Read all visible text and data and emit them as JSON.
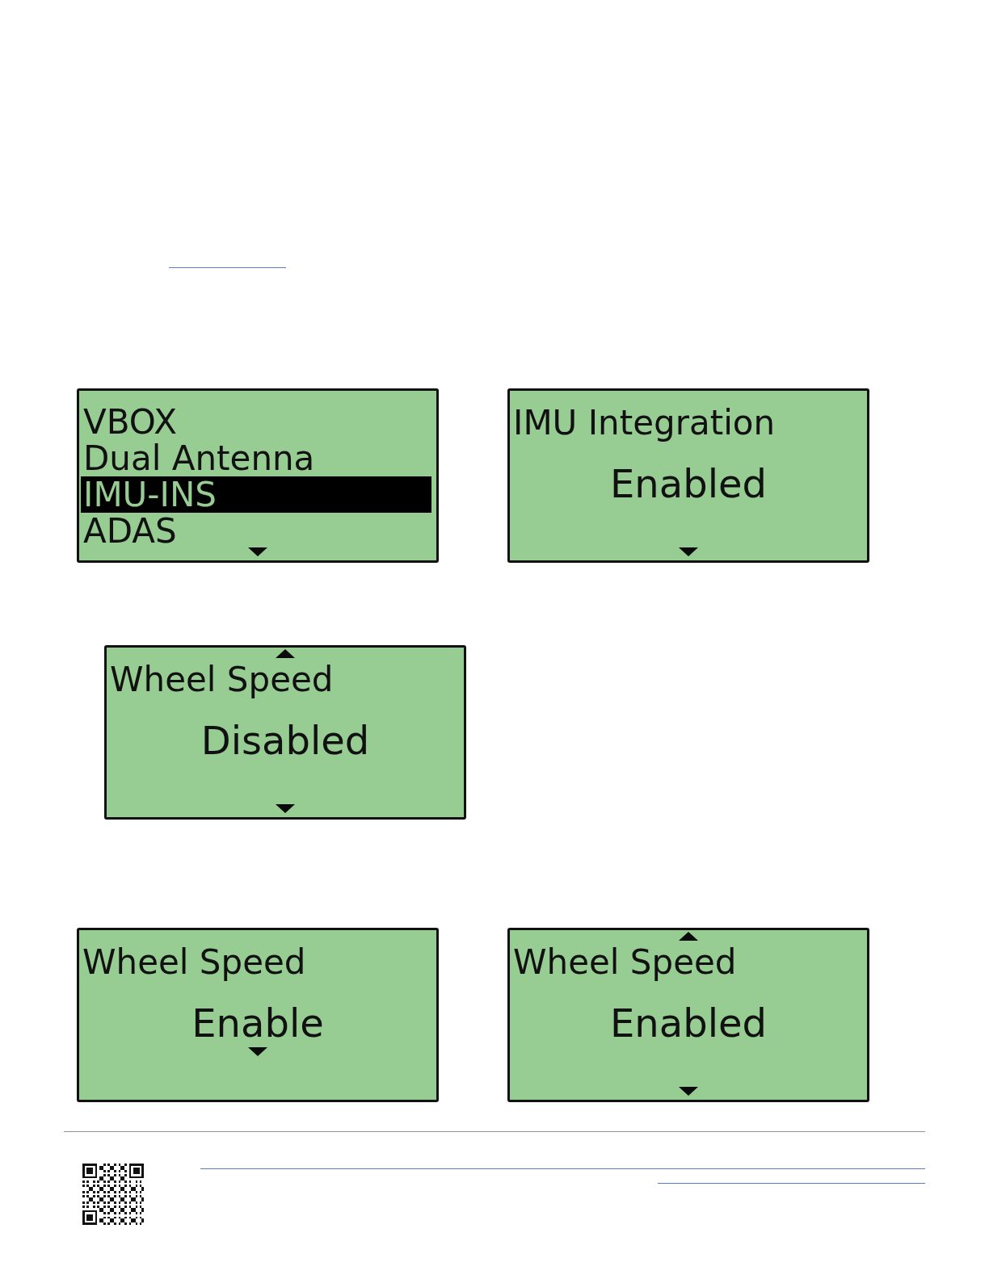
{
  "display_rows": [
    {
      "screens": [
        {
          "kind": "menu",
          "items": [
            {
              "label": "VBOX",
              "selected": false
            },
            {
              "label": "Dual Antenna",
              "selected": false
            },
            {
              "label": "IMU-INS",
              "selected": true
            },
            {
              "label": "ADAS",
              "selected": false
            }
          ],
          "scroll_up": false,
          "scroll_down": true
        },
        {
          "kind": "setting",
          "title": "IMU Integration",
          "value": "Enabled",
          "scroll_up": false,
          "scroll_down": true,
          "value_caret": false
        }
      ]
    },
    {
      "screens": [
        {
          "kind": "setting",
          "title": "Wheel Speed",
          "value": "Disabled",
          "scroll_up": true,
          "scroll_down": true,
          "value_caret": false
        }
      ]
    },
    {
      "screens": [
        {
          "kind": "setting",
          "title": "Wheel Speed",
          "value": "Enable",
          "scroll_up": false,
          "scroll_down": false,
          "value_caret": true
        },
        {
          "kind": "setting",
          "title": "Wheel Speed",
          "value": "Enabled",
          "scroll_up": true,
          "scroll_down": true,
          "value_caret": false
        }
      ]
    }
  ]
}
